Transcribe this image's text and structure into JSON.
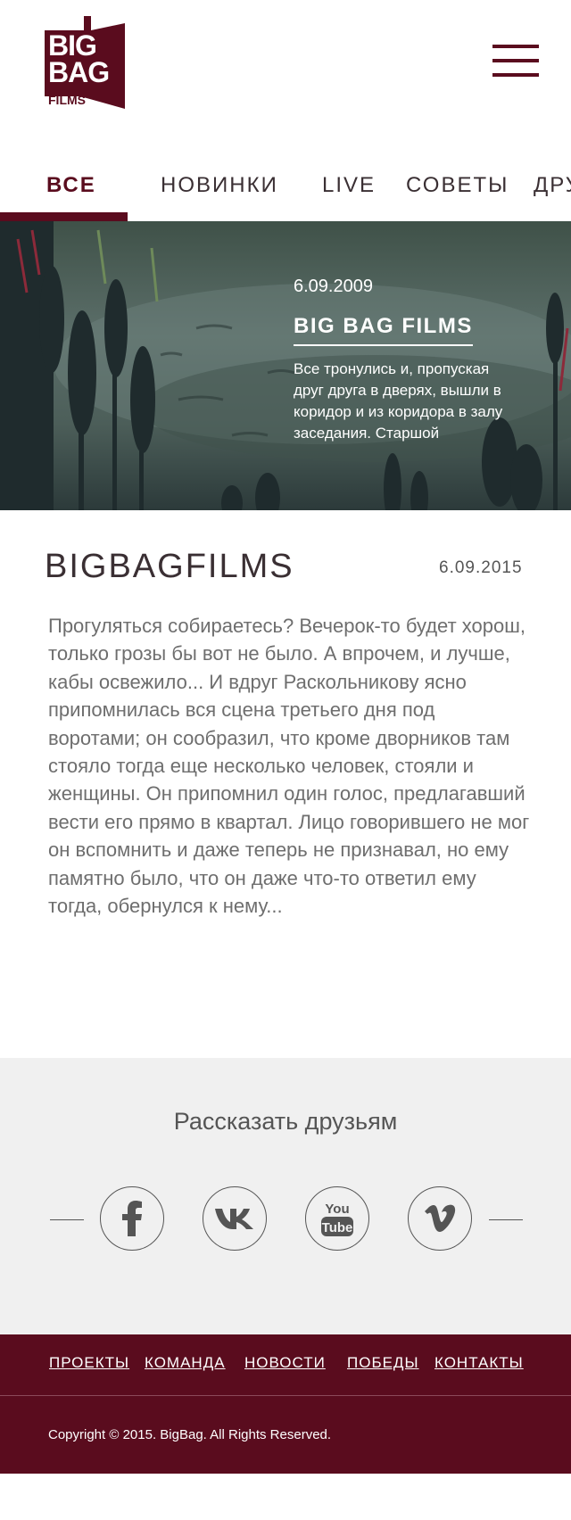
{
  "header": {
    "logo": {
      "line1": "BIG",
      "line2": "BAG",
      "line3": "FILMS"
    },
    "menu_icon": "hamburger-icon"
  },
  "tabs": [
    {
      "label": "ВСЕ",
      "active": true
    },
    {
      "label": "НОВИНКИ",
      "active": false
    },
    {
      "label": "LIVE",
      "active": false
    },
    {
      "label": "СОВЕТЫ",
      "active": false
    },
    {
      "label": "ДРУ",
      "active": false
    }
  ],
  "hero": {
    "date": "6.09.2009",
    "title": "BIG BAG FILMS",
    "text": "Все тронулись и, пропуская друг друга в дверях, вышли в коридор и из коридора в залу заседания.  Старшой"
  },
  "article": {
    "title": "BIGBAGFILMS",
    "date": "6.09.2015",
    "body": "Прогуляться собираетесь? Вечерок-то будет хорош, только грозы бы вот не было. А впрочем, и лучше, кабы освежило...   И вдруг Раскольникову ясно припомнилась вся сцена третьего дня под воротами; он сообразил, что кроме дворников там стояло тогда еще несколько человек, стояли и женщины. Он припомнил один голос, предлагавший вести его прямо в квартал. Лицо говорившего не мог он вспомнить и даже теперь не признавал, но ему памятно было, что он даже что-то ответил ему тогда, обернулся к нему..."
  },
  "share": {
    "title": "Рассказать друзьям",
    "networks": [
      {
        "icon": "facebook-icon"
      },
      {
        "icon": "vk-icon"
      },
      {
        "icon": "youtube-icon",
        "line1": "You",
        "line2": "Tube"
      },
      {
        "icon": "vimeo-icon"
      }
    ]
  },
  "footer": {
    "links": [
      "ПРОЕКТЫ",
      "КОМАНДА",
      "НОВОСТИ",
      "ПОБЕДЫ",
      "КОНТАКТЫ"
    ],
    "copyright": "Copyright © 2015. BigBag. All Rights Reserved."
  },
  "colors": {
    "brand": "#5a0c1e",
    "share_bg": "#f0f0f0",
    "text": "#3a2f33"
  }
}
